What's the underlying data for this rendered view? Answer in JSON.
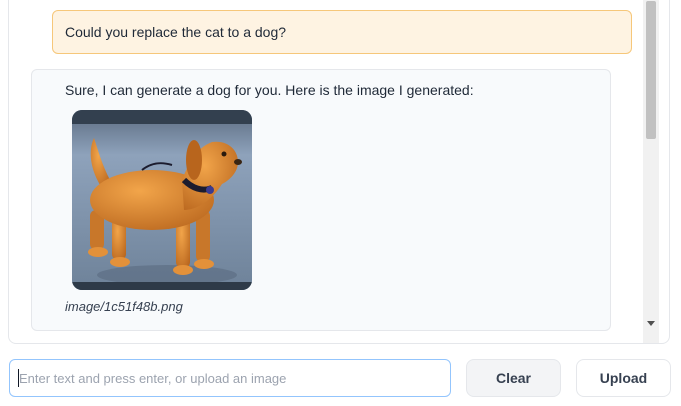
{
  "chat": {
    "user_message": "Could you replace the cat to a dog?",
    "bot_message": "Sure, I can generate a dog for you. Here is the image I generated:",
    "image_caption": "image/1c51f48b.png"
  },
  "input": {
    "placeholder": "Enter text and press enter, or upload an image",
    "value": ""
  },
  "buttons": {
    "clear_label": "Clear",
    "upload_label": "Upload"
  },
  "colors": {
    "user_bubble_bg": "#fef3e2",
    "user_bubble_border": "#f6c77a",
    "bot_bubble_bg": "#f8fafc",
    "input_focus_border": "#93c5fd"
  },
  "icons": {
    "scroll_down": "chevron-down-icon"
  }
}
